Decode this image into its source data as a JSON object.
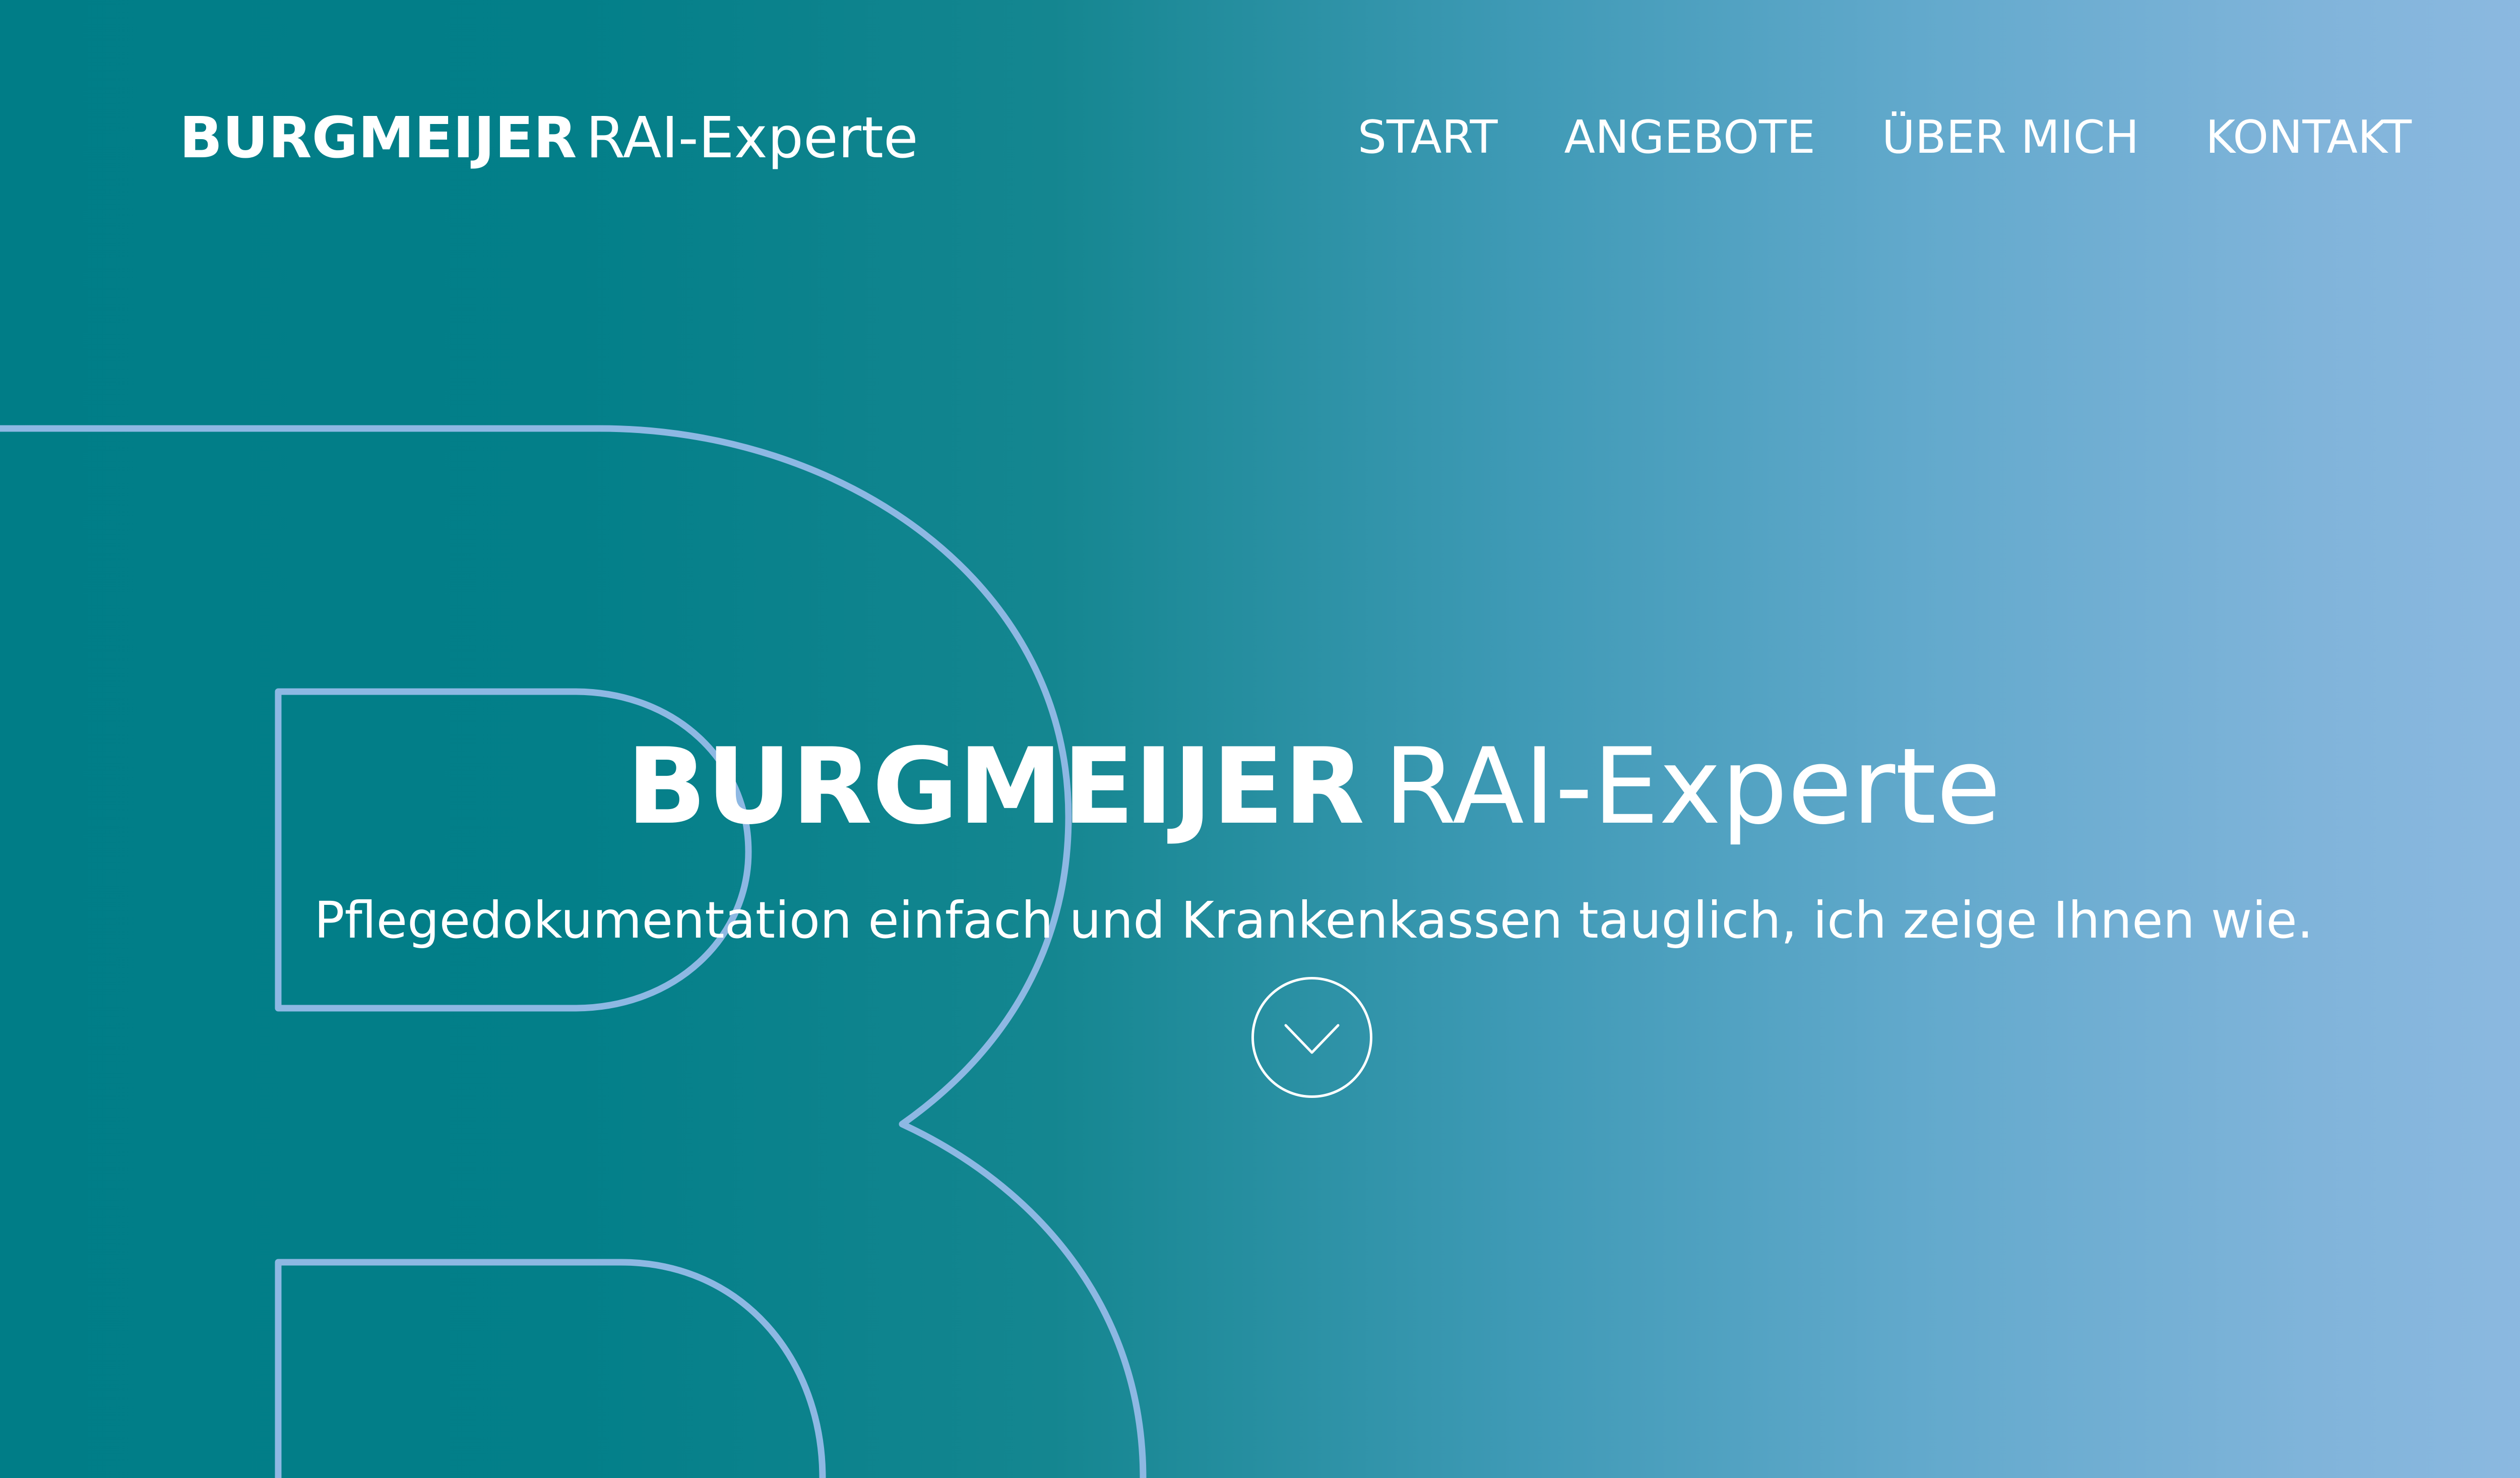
{
  "header": {
    "logo": {
      "strong": "BURGMEIJER",
      "light": "RAI-Experte"
    },
    "nav": [
      {
        "label": "START"
      },
      {
        "label": "ANGEBOTE"
      },
      {
        "label": "ÜBER MICH"
      },
      {
        "label": "KONTAKT"
      }
    ]
  },
  "hero": {
    "title": {
      "strong": "BURGMEIJER",
      "light": "RAI-Experte"
    },
    "subtitle": "Pflegedokumentation einfach und Krankenkassen tauglich, ich zeige Ihnen wie.",
    "scroll_icon": "chevron-down-icon"
  },
  "colors": {
    "gradient_start": "#007d87",
    "gradient_end": "#91bbe3",
    "outline": "#8db8e3",
    "text": "#ffffff"
  }
}
